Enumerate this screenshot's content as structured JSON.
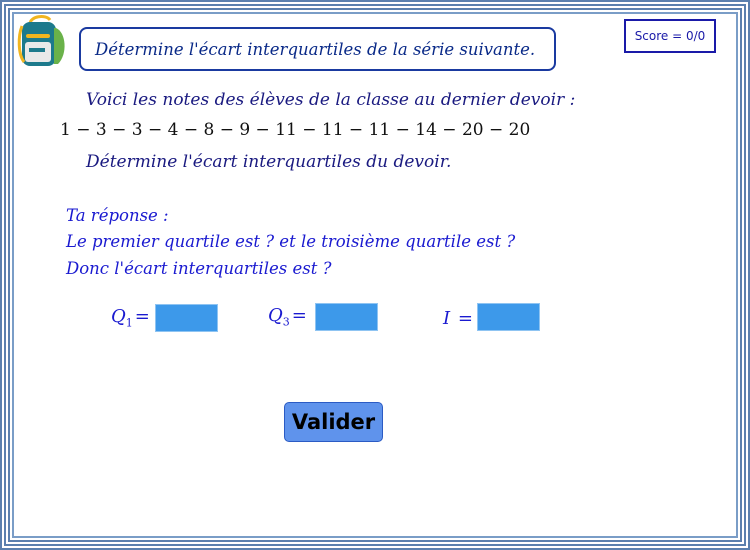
{
  "header": {
    "title": "Détermine l'écart interquartiles de la série suivante.",
    "score": "Score = 0/0",
    "logo_icon": "backpack-icon"
  },
  "problem": {
    "intro": "Voici les notes des élèves de la classe au dernier devoir  :",
    "series": "1 − 3 − 3 − 4 − 8 − 9 − 11 − 11 − 11 − 14 − 20 − 20",
    "question": "Détermine l'écart interquartiles du devoir."
  },
  "answer": {
    "heading": "Ta réponse :",
    "line1": "Le premier quartile est ? et le troisième quartile est ?",
    "line2": "Donc l'écart interquartiles est ?"
  },
  "fields": {
    "q1": {
      "var": "Q",
      "sub": "1",
      "eq": "=",
      "value": ""
    },
    "q3": {
      "var": "Q",
      "sub": "3",
      "eq": "=",
      "value": ""
    },
    "i": {
      "var": "I",
      "eq": "=",
      "value": ""
    }
  },
  "actions": {
    "validate_label": "Valider"
  },
  "colors": {
    "frame": "#5a7fae",
    "title_border": "#1a3aa0",
    "input_fill": "#3d99ea",
    "button_fill": "#5f93ec",
    "answer_text": "#1a1ad0"
  }
}
